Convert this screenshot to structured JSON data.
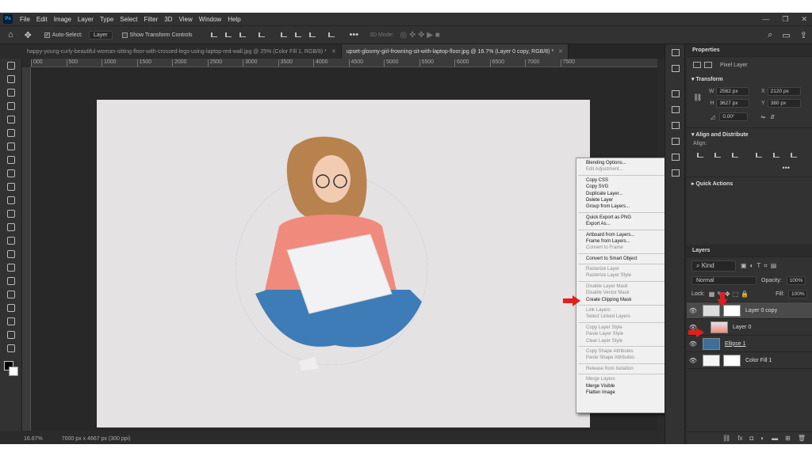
{
  "app": {
    "logo": "Ps"
  },
  "menu": [
    "File",
    "Edit",
    "Image",
    "Layer",
    "Type",
    "Select",
    "Filter",
    "3D",
    "View",
    "Window",
    "Help"
  ],
  "options": {
    "autoselect_label": "Auto-Select:",
    "autoselect_target": "Layer",
    "transform_label": "Show Transform Controls",
    "mode3d": "3D Mode:"
  },
  "tabs": [
    {
      "label": "happy-young-curly-beautiful-woman-sitting-floor-with-crossed-legs-using-laptop-red-wall.jpg @ 25% (Color Fill 1, RGB/8) *",
      "active": false
    },
    {
      "label": "upset-gloomy-girl-frowning-sit-with-laptop-floor.jpg @ 16.7% (Layer 0 copy, RGB/8) *",
      "active": true
    }
  ],
  "ruler_ticks": [
    "000",
    "500",
    "1000",
    "1500",
    "2000",
    "2500",
    "3000",
    "3500",
    "4000",
    "4500",
    "5000",
    "5500",
    "6000",
    "6500",
    "7000",
    "7500"
  ],
  "status": {
    "zoom": "16.67%",
    "docsize": "7000 px x 4667 px (300 ppi)"
  },
  "context_menu": [
    {
      "label": "Blending Options...",
      "enabled": true
    },
    {
      "label": "Edit Adjustment...",
      "enabled": false
    },
    {
      "sep": true
    },
    {
      "label": "Copy CSS",
      "enabled": true
    },
    {
      "label": "Copy SVG",
      "enabled": true
    },
    {
      "label": "Duplicate Layer...",
      "enabled": true
    },
    {
      "label": "Delete Layer",
      "enabled": true
    },
    {
      "label": "Group from Layers...",
      "enabled": true
    },
    {
      "sep": true
    },
    {
      "label": "Quick Export as PNG",
      "enabled": true
    },
    {
      "label": "Export As...",
      "enabled": true
    },
    {
      "sep": true
    },
    {
      "label": "Artboard from Layers...",
      "enabled": true
    },
    {
      "label": "Frame from Layers...",
      "enabled": true
    },
    {
      "label": "Convert to Frame",
      "enabled": false
    },
    {
      "sep": true
    },
    {
      "label": "Convert to Smart Object",
      "enabled": true
    },
    {
      "sep": true
    },
    {
      "label": "Rasterize Layer",
      "enabled": false
    },
    {
      "label": "Rasterize Layer Style",
      "enabled": false
    },
    {
      "sep": true
    },
    {
      "label": "Disable Layer Mask",
      "enabled": false
    },
    {
      "label": "Disable Vector Mask",
      "enabled": false
    },
    {
      "label": "Create Clipping Mask",
      "enabled": true
    },
    {
      "sep": true
    },
    {
      "label": "Link Layers",
      "enabled": false
    },
    {
      "label": "Select Linked Layers",
      "enabled": false
    },
    {
      "sep": true
    },
    {
      "label": "Copy Layer Style",
      "enabled": false
    },
    {
      "label": "Paste Layer Style",
      "enabled": false
    },
    {
      "label": "Clear Layer Style",
      "enabled": false
    },
    {
      "sep": true
    },
    {
      "label": "Copy Shape Attributes",
      "enabled": false
    },
    {
      "label": "Paste Shape Attributes",
      "enabled": false
    },
    {
      "sep": true
    },
    {
      "label": "Release from Isolation",
      "enabled": false
    },
    {
      "sep": true
    },
    {
      "label": "Merge Layers",
      "enabled": false
    },
    {
      "label": "Merge Visible",
      "enabled": true
    },
    {
      "label": "Flatten Image",
      "enabled": true
    }
  ],
  "properties": {
    "title": "Properties",
    "kind": "Pixel Layer",
    "transform": "Transform",
    "w": "2562 px",
    "h": "3627 px",
    "x": "2120 px",
    "y": "380 px",
    "angle": "0.00°",
    "align_title": "Align and Distribute",
    "align_label": "Align:",
    "quick": "Quick Actions"
  },
  "layers": {
    "title": "Layers",
    "filter": "Kind",
    "blend": "Normal",
    "opacity_label": "Opacity:",
    "opacity": "100%",
    "lock_label": "Lock:",
    "fill_label": "Fill:",
    "fill": "100%",
    "items": [
      {
        "name": "Layer 0 copy",
        "selected": true
      },
      {
        "name": "Layer 0",
        "selected": false
      },
      {
        "name": "Ellipse 1",
        "selected": false
      },
      {
        "name": "Color Fill 1",
        "selected": false
      }
    ]
  },
  "colors": {
    "accent": "#2f87b3",
    "annotation": "#e02020",
    "hoodie": "#f08a7c"
  }
}
